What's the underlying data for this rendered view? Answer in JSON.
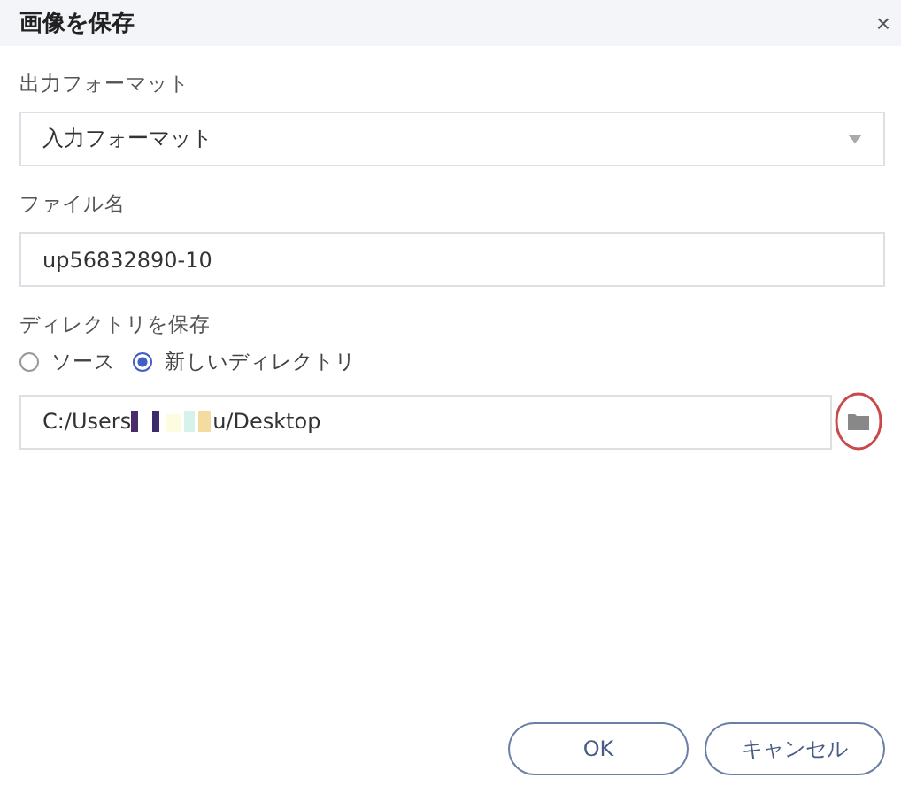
{
  "window": {
    "title": "画像を保存",
    "close": "×"
  },
  "format": {
    "label": "出力フォーマット",
    "value": "入力フォーマット"
  },
  "filename": {
    "label": "ファイル名",
    "value": "up56832890-10"
  },
  "directory": {
    "label": "ディレクトリを保存",
    "options": [
      {
        "label": "ソース",
        "selected": false
      },
      {
        "label": "新しいディレクトリ",
        "selected": true
      }
    ],
    "path_start": "C:/Users",
    "path_end": "u/Desktop"
  },
  "buttons": [
    {
      "label": "OK"
    },
    {
      "label": "キャンセル"
    }
  ]
}
